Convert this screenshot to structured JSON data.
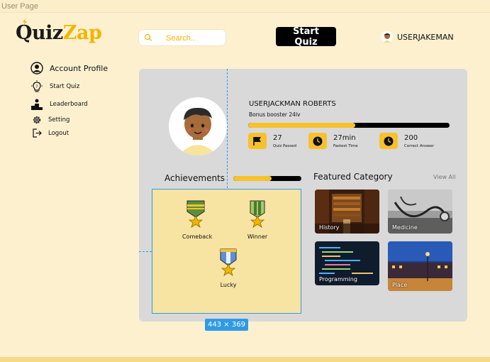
{
  "frame_label": "User Page",
  "logo": {
    "part1": "Quiz",
    "part2": "Zap"
  },
  "search": {
    "placeholder": "Search.."
  },
  "header": {
    "start_quiz": "Start Quiz",
    "username": "USERJAKEMAN"
  },
  "sidebar": {
    "items": [
      {
        "label": "Account Profile",
        "icon": "user-circle-icon"
      },
      {
        "label": "Start Quiz",
        "icon": "lightbulb-icon"
      },
      {
        "label": "Leaderboard",
        "icon": "podium-icon"
      },
      {
        "label": "Setting",
        "icon": "gear-icon"
      },
      {
        "label": "Logout",
        "icon": "logout-icon"
      }
    ]
  },
  "profile": {
    "name": "USERJACKMAN ROBERTS",
    "subtitle": "Bonus booster 24lv",
    "progress": 0.53
  },
  "stats": [
    {
      "value": "27",
      "label": "Quiz Passed",
      "icon": "flag-icon"
    },
    {
      "value": "27min",
      "label": "Fastest Time",
      "icon": "clock-icon"
    },
    {
      "value": "200",
      "label": "Correct Answer",
      "icon": "clock-icon"
    }
  ],
  "achievements": {
    "title": "Achievements",
    "progress": 0.56,
    "medals": [
      {
        "label": "Comeback",
        "icon": "medal-icon"
      },
      {
        "label": "Winner",
        "icon": "medal-icon"
      },
      {
        "label": "Lucky",
        "icon": "medal-icon"
      }
    ],
    "selection_size": "443 × 369"
  },
  "featured": {
    "title": "Featured Category",
    "view_all": "View All",
    "categories": [
      {
        "label": "History"
      },
      {
        "label": "Medicine"
      },
      {
        "label": "Programming"
      },
      {
        "label": "Place"
      }
    ]
  },
  "colors": {
    "accent": "#f7c12c",
    "background": "#fcf0cf",
    "panel": "#d9d9d9",
    "selection": "#2f9be6"
  }
}
